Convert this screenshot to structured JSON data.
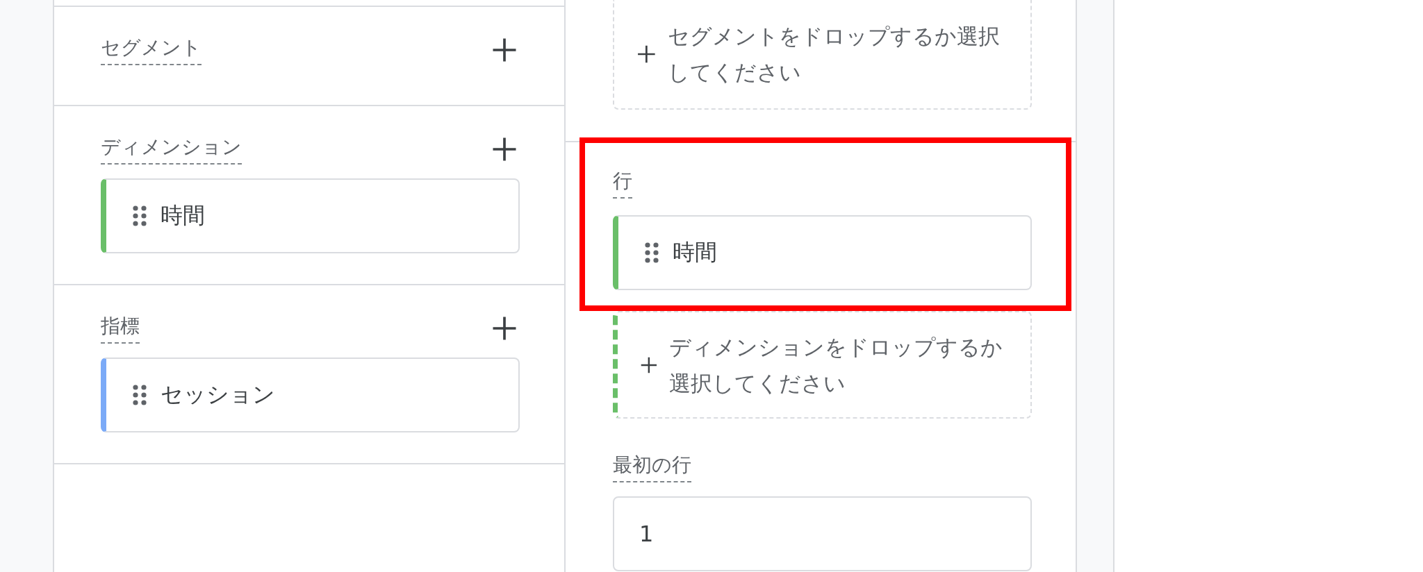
{
  "variables": {
    "sections": [
      {
        "title": "セグメント"
      },
      {
        "title": "ディメンション",
        "items": [
          {
            "label": "時間",
            "color": "#6abf69"
          }
        ]
      },
      {
        "title": "指標",
        "items": [
          {
            "label": "セッション",
            "color": "#7baaf7"
          }
        ]
      }
    ]
  },
  "settings": {
    "segment_drop": {
      "text": "セグメントをドロップするか選択してください"
    },
    "rows": {
      "title": "行",
      "highlighted": true,
      "items": [
        {
          "label": "時間",
          "color": "#6abf69"
        }
      ],
      "drop_zone": {
        "text": "ディメンションをドロップするか選択してください",
        "color": "#6abf69"
      }
    },
    "first_row": {
      "title": "最初の行",
      "value": "1"
    }
  }
}
